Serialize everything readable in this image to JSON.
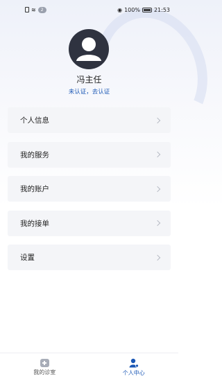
{
  "status_bar": {
    "notification_count": "2",
    "battery": "100%",
    "time": "21:53"
  },
  "profile": {
    "name": "冯主任",
    "auth_link": "未认证，去认证"
  },
  "menu": {
    "items": [
      {
        "label": "个人信息"
      },
      {
        "label": "我的服务"
      },
      {
        "label": "我的账户"
      },
      {
        "label": "我的接单"
      },
      {
        "label": "设置"
      }
    ]
  },
  "tab_bar": {
    "tabs": [
      {
        "label": "我的诊室",
        "active": false
      },
      {
        "label": "个人中心",
        "active": true
      }
    ]
  },
  "colors": {
    "accent": "#1a57b5",
    "avatar_bg": "#2f3340",
    "menu_item_bg": "#f4f5f8"
  }
}
